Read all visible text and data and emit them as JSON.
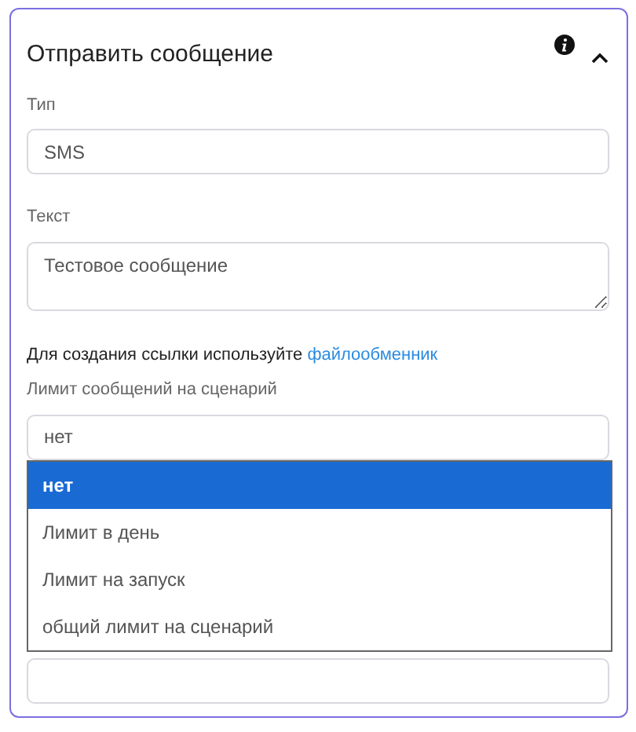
{
  "panel": {
    "title": "Отправить сообщение",
    "expanded": true
  },
  "fields": [
    {
      "label": "Тип",
      "kind": "input",
      "value": "SMS"
    },
    {
      "label": "Текст",
      "kind": "textarea",
      "value": "Тестовое сообщение"
    }
  ],
  "hint": {
    "text": "Для создания ссылки используйте ",
    "link": "файлообменник"
  },
  "limit": {
    "label": "Лимит сообщений на сценарий",
    "value": "нет",
    "options": [
      {
        "label": "нет",
        "selected": true
      },
      {
        "label": "Лимит в день",
        "selected": false
      },
      {
        "label": "Лимит на запуск",
        "selected": false
      },
      {
        "label": "общий лимит на сценарий",
        "selected": false
      }
    ]
  },
  "last_field": {
    "kind": "input"
  }
}
